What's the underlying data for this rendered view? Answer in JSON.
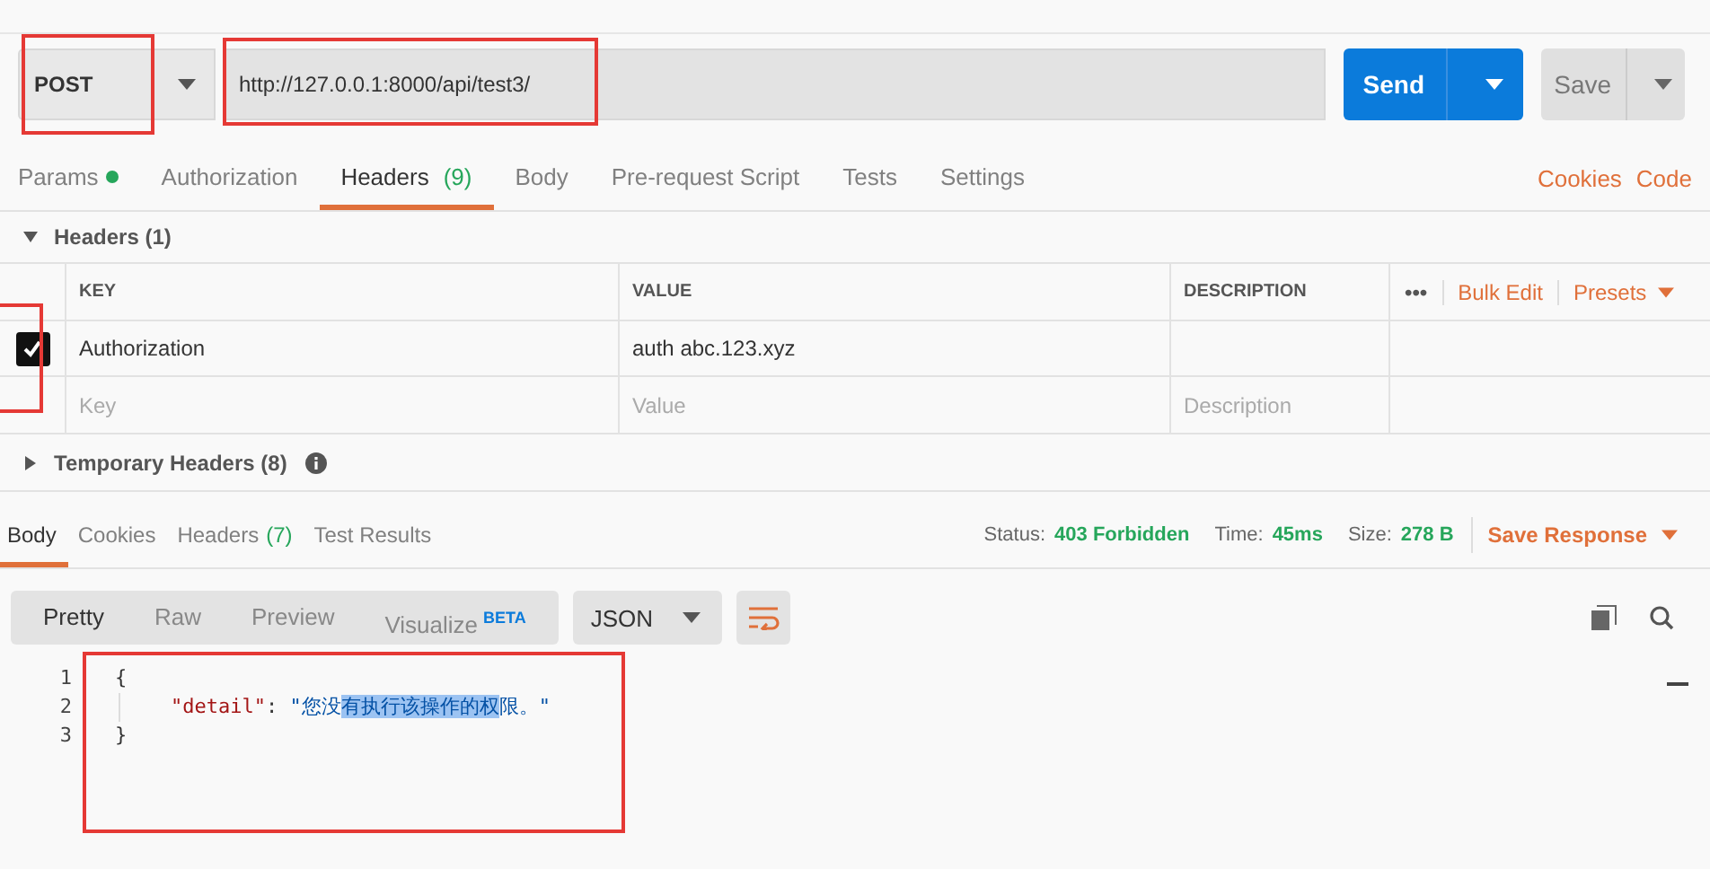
{
  "request": {
    "method": "POST",
    "method_highlighted": true,
    "url": "http://127.0.0.1:8000/api/test3/",
    "url_highlighted": true,
    "send": "Send",
    "save": "Save"
  },
  "request_tabs": [
    {
      "label": "Params",
      "dot": true,
      "selected": false
    },
    {
      "label": "Authorization",
      "selected": false
    },
    {
      "label": "Headers",
      "count": "(9)",
      "selected": true
    },
    {
      "label": "Body",
      "selected": false
    },
    {
      "label": "Pre-request Script",
      "selected": false
    },
    {
      "label": "Tests",
      "selected": false
    },
    {
      "label": "Settings",
      "selected": false
    }
  ],
  "links": [
    "Cookies",
    "Code"
  ],
  "headers_section": {
    "title": "Headers",
    "count": "(1)",
    "expanded": true
  },
  "table": {
    "columns": [
      "KEY",
      "VALUE",
      "DESCRIPTION"
    ],
    "more": "•••",
    "bulk_edit": "Bulk Edit",
    "presets": "Presets",
    "rows": [
      {
        "checked": true,
        "highlighted": true,
        "key": "Authorization",
        "value": "auth abc.123.xyz"
      }
    ],
    "placeholder_row": [
      {
        "placeholder": "Key"
      },
      {
        "placeholder": "Value"
      },
      {
        "placeholder": "Description"
      }
    ]
  },
  "temporary_headers": {
    "title": "Temporary Headers",
    "count": "(8)",
    "expanded": false
  },
  "response_tabs": [
    {
      "label": "Body",
      "selected": true
    },
    {
      "label": "Cookies",
      "selected": false
    },
    {
      "label": "Headers",
      "count": "(7)",
      "selected": false
    },
    {
      "label": "Test Results",
      "selected": false
    }
  ],
  "status": [
    {
      "label": "Status:",
      "value": "403 Forbidden"
    },
    {
      "label": "Time:",
      "value": "45ms"
    },
    {
      "label": "Size:",
      "value": "278 B"
    }
  ],
  "save_response": "Save Response",
  "view_modes": [
    {
      "label": "Pretty",
      "selected": true
    },
    {
      "label": "Raw",
      "selected": false
    },
    {
      "label": "Preview",
      "selected": false
    },
    {
      "label": "Visualize",
      "badge": "BETA",
      "selected": false
    }
  ],
  "format": "JSON",
  "body": {
    "highlighted": true,
    "lines": [
      {
        "number": "1",
        "segments": [
          {
            "text": "{",
            "kind": "punct",
            "selected": false
          }
        ]
      },
      {
        "number": "2",
        "segments": [
          {
            "text": "\"detail\"",
            "kind": "key",
            "selected": false
          },
          {
            "text": ": ",
            "kind": "punct",
            "selected": false
          },
          {
            "text": "\"您没",
            "kind": "string",
            "selected": false
          },
          {
            "text": "有执行该操作的权",
            "kind": "string",
            "selected": true
          },
          {
            "text": "限。\"",
            "kind": "string",
            "selected": false
          }
        ]
      },
      {
        "number": "3",
        "segments": [
          {
            "text": "}",
            "kind": "punct",
            "selected": false
          }
        ]
      }
    ]
  }
}
